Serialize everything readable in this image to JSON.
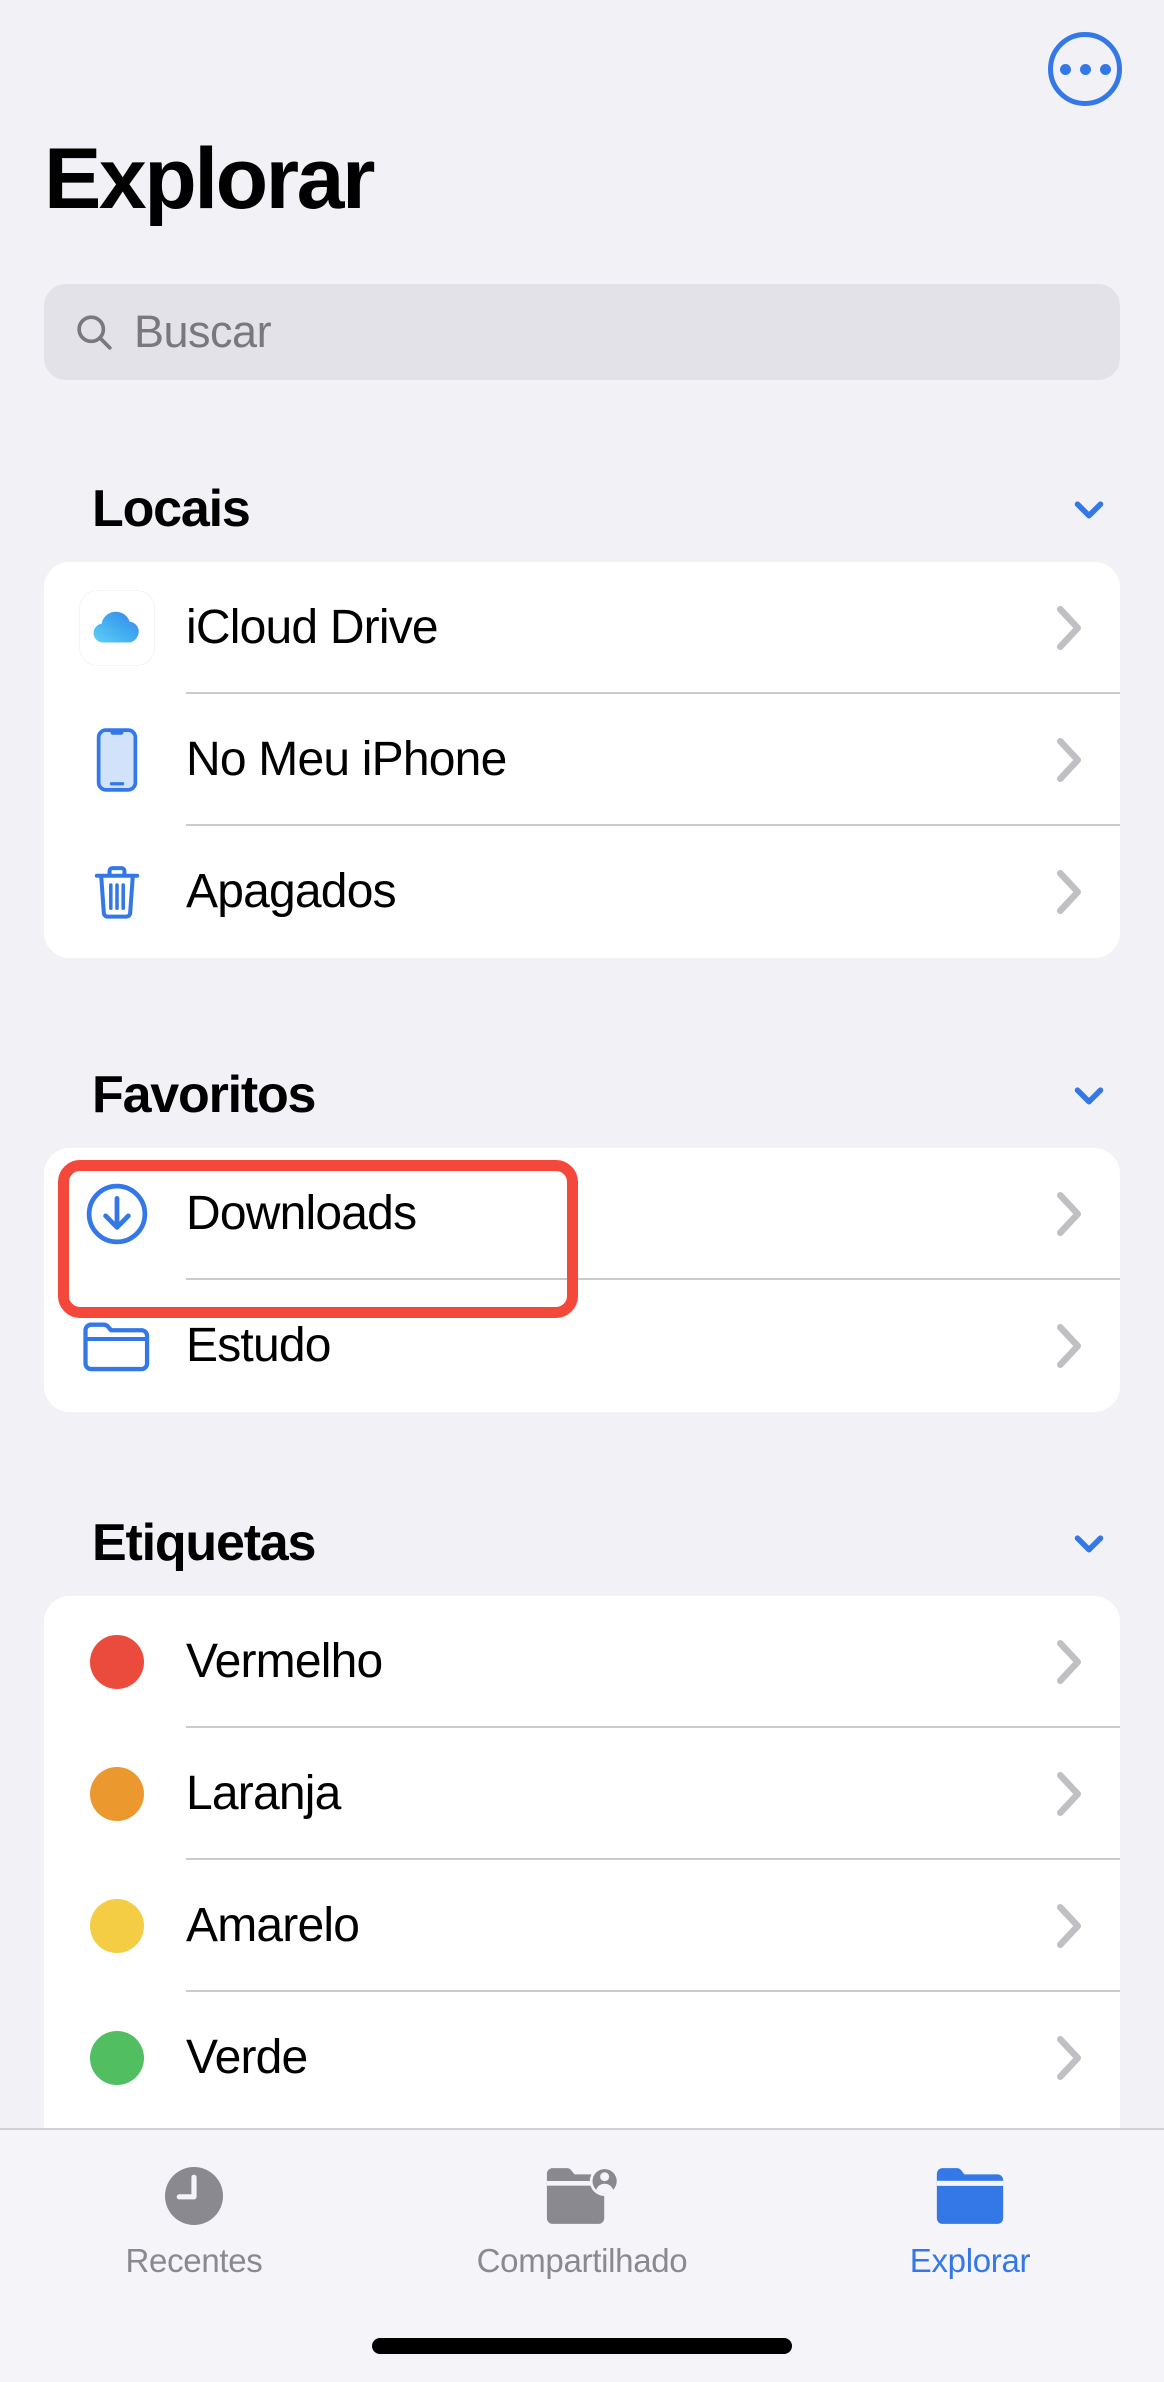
{
  "header": {
    "title": "Explorar",
    "more_button_label": "more-options"
  },
  "search": {
    "placeholder": "Buscar",
    "value": ""
  },
  "sections": [
    {
      "id": "locais",
      "title": "Locais",
      "collapse_icon": "chevron-down-icon",
      "items": [
        {
          "label": "iCloud Drive",
          "icon": "icloud-icon",
          "accessory": "chevron-right-icon"
        },
        {
          "label": "No Meu iPhone",
          "icon": "iphone-icon",
          "accessory": "chevron-right-icon"
        },
        {
          "label": "Apagados",
          "icon": "trash-icon",
          "accessory": "chevron-right-icon"
        }
      ]
    },
    {
      "id": "favoritos",
      "title": "Favoritos",
      "collapse_icon": "chevron-down-icon",
      "items": [
        {
          "label": "Downloads",
          "icon": "download-circle-icon",
          "accessory": "chevron-right-icon",
          "highlighted": true
        },
        {
          "label": "Estudo",
          "icon": "folder-outline-icon",
          "accessory": "chevron-right-icon"
        }
      ]
    },
    {
      "id": "etiquetas",
      "title": "Etiquetas",
      "collapse_icon": "chevron-down-icon",
      "items": [
        {
          "label": "Vermelho",
          "icon": "tag-dot-icon",
          "color": "#ea4b3c",
          "accessory": "chevron-right-icon"
        },
        {
          "label": "Laranja",
          "icon": "tag-dot-icon",
          "color": "#eb982f",
          "accessory": "chevron-right-icon"
        },
        {
          "label": "Amarelo",
          "icon": "tag-dot-icon",
          "color": "#f5cd44",
          "accessory": "chevron-right-icon"
        },
        {
          "label": "Verde",
          "icon": "tag-dot-icon",
          "color": "#51be62",
          "accessory": "chevron-right-icon"
        }
      ]
    }
  ],
  "tabbar": {
    "tabs": [
      {
        "label": "Recentes",
        "icon": "clock-icon",
        "active": false
      },
      {
        "label": "Compartilhado",
        "icon": "shared-folder-icon",
        "active": false
      },
      {
        "label": "Explorar",
        "icon": "folder-icon",
        "active": true
      }
    ]
  },
  "colors": {
    "accent_blue": "#3478e8",
    "highlight_red": "#f4483b",
    "background": "#f2f1f6",
    "card": "#ffffff",
    "separator": "#c9c9ce",
    "secondary_text": "#8a898f",
    "placeholder_text": "#78787e"
  }
}
